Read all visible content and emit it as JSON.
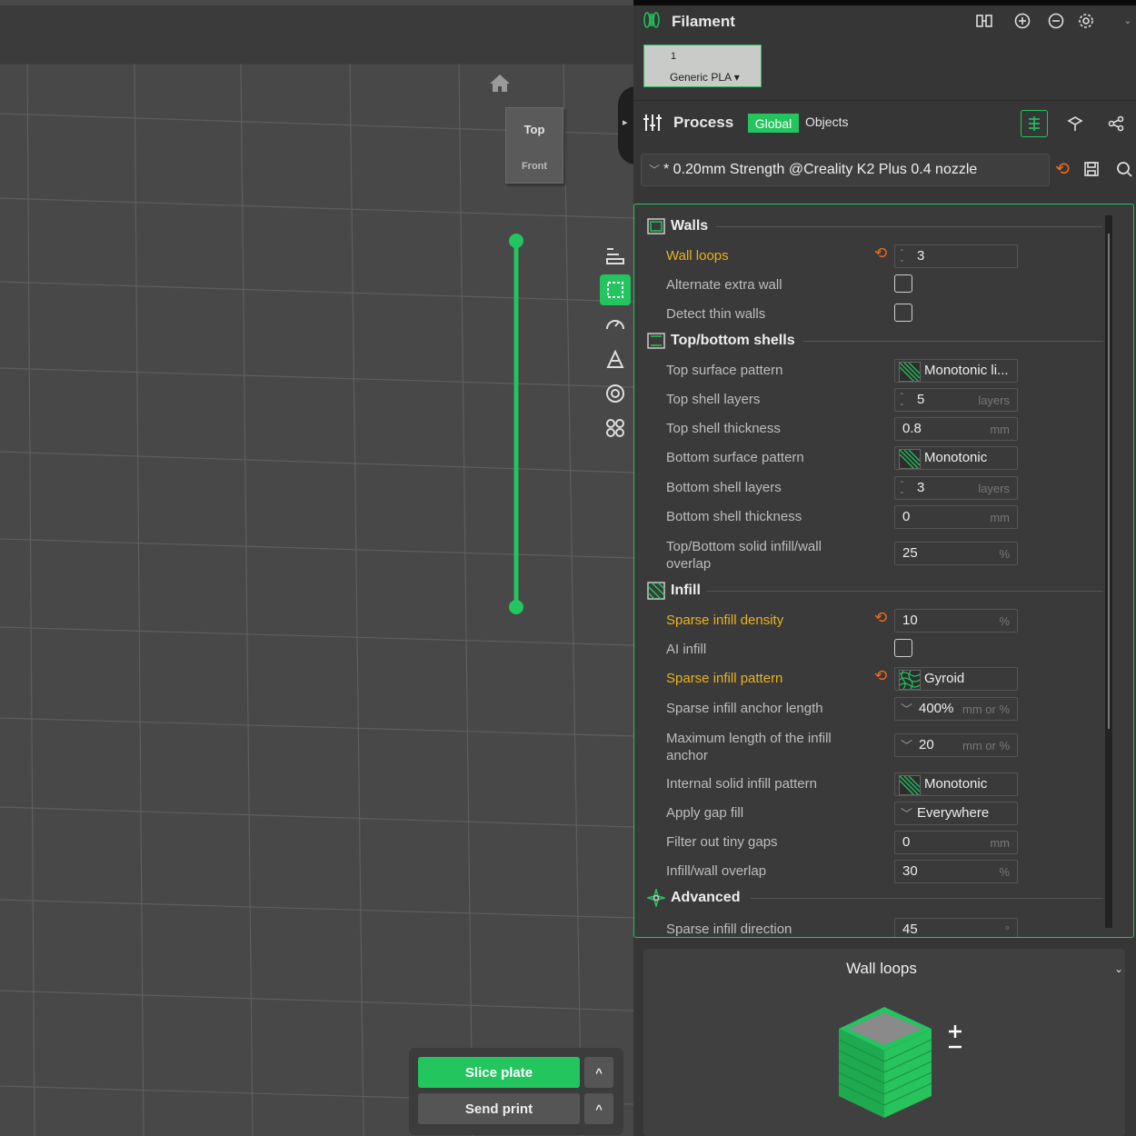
{
  "viewport": {
    "cube_top": "Top",
    "cube_front": "Front",
    "slice_label": "Slice plate",
    "send_label": "Send print",
    "caret": "^"
  },
  "filament": {
    "title": "Filament",
    "slot_number": "1",
    "slot_name": "Generic PLA ▾"
  },
  "process": {
    "title": "Process",
    "global_label": "Global",
    "objects_label": "Objects",
    "preset": "* 0.20mm Strength @Creality K2 Plus 0.4 nozzle"
  },
  "sections": {
    "walls": "Walls",
    "topbottom": "Top/bottom shells",
    "infill": "Infill",
    "advanced": "Advanced"
  },
  "rows": {
    "wall_loops": {
      "label": "Wall loops",
      "value": "3"
    },
    "alt_extra_wall": {
      "label": "Alternate extra wall"
    },
    "detect_thin": {
      "label": "Detect thin walls"
    },
    "top_surface_pattern": {
      "label": "Top surface pattern",
      "value": "Monotonic li..."
    },
    "top_shell_layers": {
      "label": "Top shell layers",
      "value": "5",
      "unit": "layers"
    },
    "top_shell_thickness": {
      "label": "Top shell thickness",
      "value": "0.8",
      "unit": "mm"
    },
    "bottom_surface_pattern": {
      "label": "Bottom surface pattern",
      "value": "Monotonic"
    },
    "bottom_shell_layers": {
      "label": "Bottom shell layers",
      "value": "3",
      "unit": "layers"
    },
    "bottom_shell_thickness": {
      "label": "Bottom shell thickness",
      "value": "0",
      "unit": "mm"
    },
    "tb_overlap": {
      "label1": "Top/Bottom solid infill/wall",
      "label2": "overlap",
      "value": "25",
      "unit": "%"
    },
    "sparse_density": {
      "label": "Sparse infill density",
      "value": "10",
      "unit": "%"
    },
    "ai_infill": {
      "label": "AI infill"
    },
    "sparse_pattern": {
      "label": "Sparse infill pattern",
      "value": "Gyroid"
    },
    "anchor_length": {
      "label": "Sparse infill anchor length",
      "value": "400%",
      "unit": "mm or %"
    },
    "max_anchor": {
      "label1": "Maximum length of the infill",
      "label2": "anchor",
      "value": "20",
      "unit": "mm or %"
    },
    "internal_solid": {
      "label": "Internal solid infill pattern",
      "value": "Monotonic"
    },
    "gap_fill": {
      "label": "Apply gap fill",
      "value": "Everywhere"
    },
    "tiny_gaps": {
      "label": "Filter out tiny gaps",
      "value": "0",
      "unit": "mm"
    },
    "infill_wall_overlap": {
      "label": "Infill/wall overlap",
      "value": "30",
      "unit": "%"
    },
    "sparse_direction": {
      "label": "Sparse infill direction",
      "value": "45",
      "unit": "°"
    }
  },
  "help": {
    "title": "Wall loops"
  },
  "colors": {
    "accent": "#22c55e",
    "modified": "#e8b320",
    "reset": "#f26b1d"
  }
}
